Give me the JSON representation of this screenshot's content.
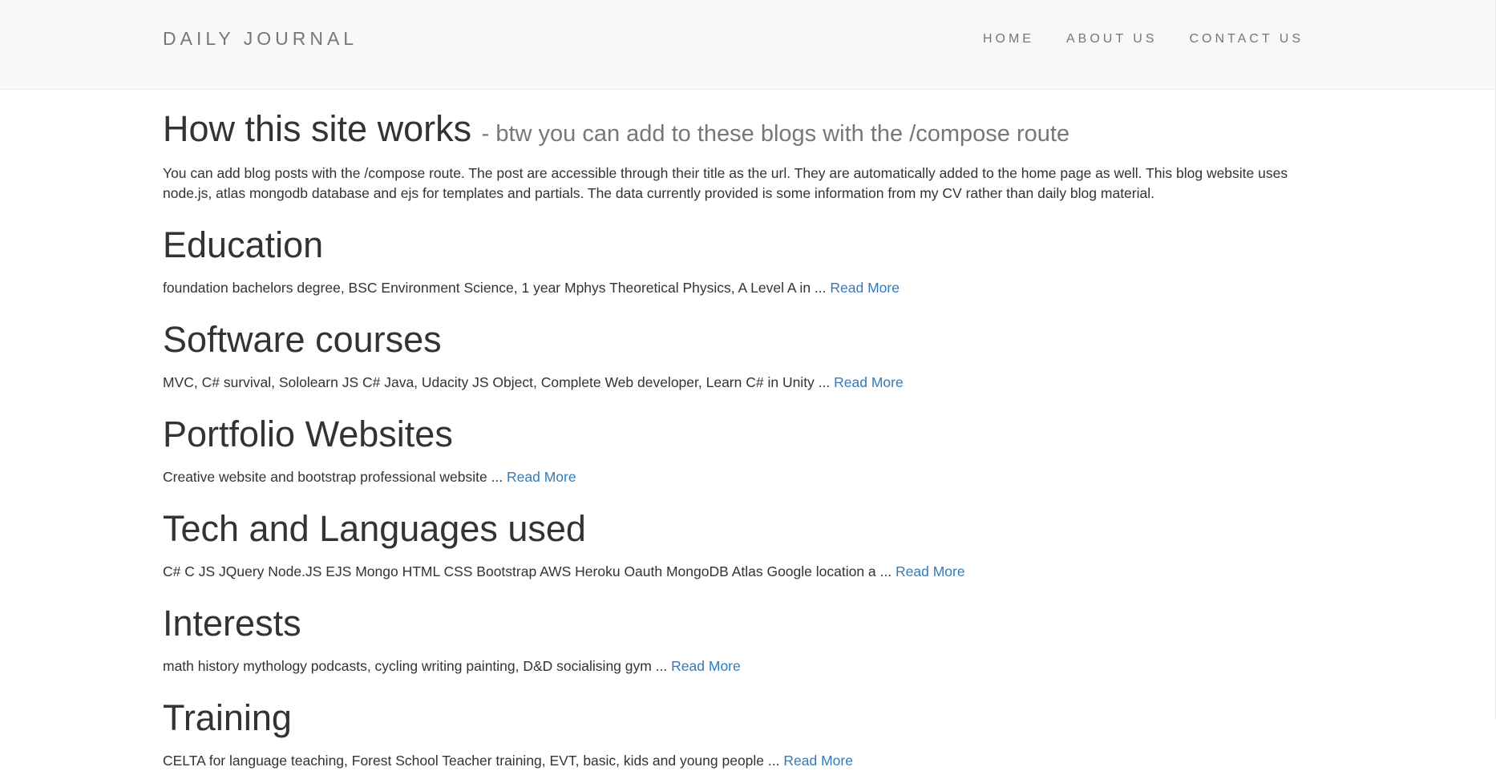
{
  "navbar": {
    "brand": "DAILY JOURNAL",
    "links": [
      "HOME",
      "ABOUT US",
      "CONTACT US"
    ]
  },
  "intro": {
    "title": "How this site works",
    "subtitle": "- btw you can add to these blogs with the /compose route",
    "body": "You can add blog posts with the /compose route. The post are accessible through their title as the url. They are automatically added to the home page as well. This blog website uses node.js, atlas mongodb database and ejs for templates and partials. The data currently provided is some information from my CV rather than daily blog material."
  },
  "posts": [
    {
      "title": "Education",
      "excerpt": "foundation bachelors degree, BSC Environment Science, 1 year Mphys Theoretical Physics, A Level A in ...",
      "read_more": "Read More"
    },
    {
      "title": "Software courses",
      "excerpt": "MVC, C# survival, Sololearn JS C# Java, Udacity JS Object, Complete Web developer, Learn C# in Unity ...",
      "read_more": "Read More"
    },
    {
      "title": "Portfolio Websites",
      "excerpt": "Creative website and bootstrap professional website ...",
      "read_more": "Read More"
    },
    {
      "title": "Tech and Languages used",
      "excerpt": "C# C JS JQuery Node.JS EJS Mongo HTML CSS Bootstrap AWS Heroku Oauth MongoDB Atlas Google location a ...",
      "read_more": "Read More"
    },
    {
      "title": "Interests",
      "excerpt": "math history mythology podcasts, cycling writing painting, D&D socialising gym ...",
      "read_more": "Read More"
    },
    {
      "title": "Training",
      "excerpt": "CELTA for language teaching, Forest School Teacher training, EVT, basic, kids and young people ...",
      "read_more": "Read More"
    }
  ]
}
